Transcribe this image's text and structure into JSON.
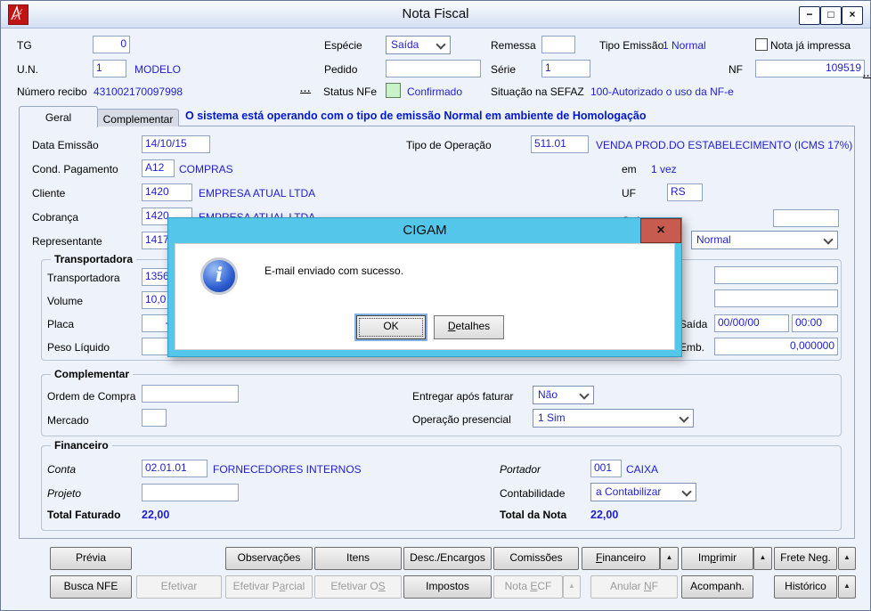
{
  "window": {
    "title": "Nota Fiscal"
  },
  "icons": {
    "minimize": "−",
    "maximize": "□",
    "close": "×",
    "dialog_close": "×",
    "info": "i",
    "arrow_up": "▲",
    "more_dots": "...",
    "check_unchecked": ""
  },
  "colors": {
    "value_blue": "#1f1fd0",
    "banner_blue": "#0018cc",
    "status_green_bg": "#c9f2c9",
    "dialog_cyan": "#54c6e9",
    "dialog_close_red": "#c75b50",
    "logo_red": "#c01414"
  },
  "header": {
    "tg_label": "TG",
    "tg_value": "0",
    "especie_label": "Espécie",
    "especie_value": "Saída",
    "remessa_label": "Remessa",
    "remessa_value": "",
    "tipo_emissao_label": "Tipo Emissão",
    "tipo_emissao_value": "1 Normal",
    "nota_ja_impressa_label": "Nota já impressa",
    "un_label": "U.N.",
    "un_value": "1",
    "un_desc": "MODELO",
    "pedido_label": "Pedido",
    "pedido_value": "",
    "serie_label": "Série",
    "serie_value": "1",
    "nf_label": "NF",
    "nf_value": "109519",
    "numero_recibo_label": "Número recibo",
    "numero_recibo_value": "431002170097998",
    "status_nfe_label": "Status NFe",
    "status_nfe_value": "Confirmado",
    "situacao_label": "Situação na SEFAZ",
    "situacao_value": "100-Autorizado o uso da NF-e"
  },
  "tabs": {
    "geral": "Geral",
    "complementar": "Complementar",
    "banner": "O sistema está operando com o tipo de emissão Normal em ambiente de Homologação"
  },
  "geral": {
    "data_emissao_label": "Data Emissão",
    "data_emissao_value": "14/10/15",
    "tipo_operacao_label": "Tipo de Operação",
    "tipo_operacao_value": "511.01",
    "tipo_operacao_desc": "VENDA PROD.DO ESTABELECIMENTO (ICMS 17%)",
    "cond_pagamento_label": "Cond. Pagamento",
    "cond_pagamento_value": "A12",
    "cond_pagamento_desc": "COMPRAS",
    "em_label": "em",
    "em_value": "1 vez",
    "cliente_label": "Cliente",
    "cliente_value": "1420",
    "cliente_desc": "EMPRESA ATUAL LTDA",
    "uf_label": "UF",
    "uf_value": "RS",
    "cobranca_label": "Cobrança",
    "cobranca_value": "1420",
    "cobranca_desc": "EMPRESA ATUAL LTDA",
    "ordem_label": "Ordem",
    "ordem_value": "",
    "representante_label": "Representante",
    "representante_value": "1417",
    "tipo_nota_value": "Normal"
  },
  "transportadora": {
    "group_label": "Transportadora",
    "transportadora_label": "Transportadora",
    "transportadora_value": "1356",
    "volume_label": "Volume",
    "volume_value": "10,0",
    "placa_label": "Placa",
    "placa_value": "-",
    "peso_liquido_label": "Peso Líquido",
    "peso_liquido_value": "",
    "right_field1_value": "",
    "right_field2_value": "",
    "saida_label": "Saída",
    "saida_date_value": "00/00/00",
    "saida_time_value": "00:00",
    "emb_label": "Emb.",
    "emb_value": "0,000000"
  },
  "complementar": {
    "group_label": "Complementar",
    "ordem_compra_label": "Ordem de Compra",
    "ordem_compra_value": "",
    "mercado_label": "Mercado",
    "mercado_value": "",
    "entregar_label": "Entregar após faturar",
    "entregar_value": "Não",
    "operacao_label": "Operação presencial",
    "operacao_value": "1 Sim"
  },
  "financeiro": {
    "group_label": "Financeiro",
    "conta_label": "Conta",
    "conta_value": "02.01.01",
    "conta_desc": "FORNECEDORES INTERNOS",
    "portador_label": "Portador",
    "portador_value": "001",
    "portador_desc": "CAIXA",
    "projeto_label": "Projeto",
    "projeto_value": "",
    "contabilidade_label": "Contabilidade",
    "contabilidade_value": "a Contabilizar",
    "total_faturado_label": "Total Faturado",
    "total_faturado_value": "22,00",
    "total_nota_label": "Total da Nota",
    "total_nota_value": "22,00"
  },
  "buttons": {
    "previa": "Prévia",
    "observacoes": "Observações",
    "itens": "Itens",
    "desc_encargos": "Desc./Encargos",
    "comissoes": "Comissões",
    "financeiro": "Financeiro",
    "imprimir": "Imprimir",
    "frete_neg": "Frete Neg.",
    "busca_nfe": "Busca NFE",
    "efetivar": "Efetivar",
    "efetivar_parcial": "Efetivar Parcial",
    "efetivar_os": "Efetivar OS",
    "impostos": "Impostos",
    "nota_ecf": "Nota ECF",
    "anular_nf": "Anular NF",
    "acompanh": "Acompanh.",
    "historico": "Histórico"
  },
  "dialog": {
    "title": "CIGAM",
    "message": "E-mail enviado com sucesso.",
    "ok_label": "OK",
    "detalhes_label": "Detalhes"
  }
}
